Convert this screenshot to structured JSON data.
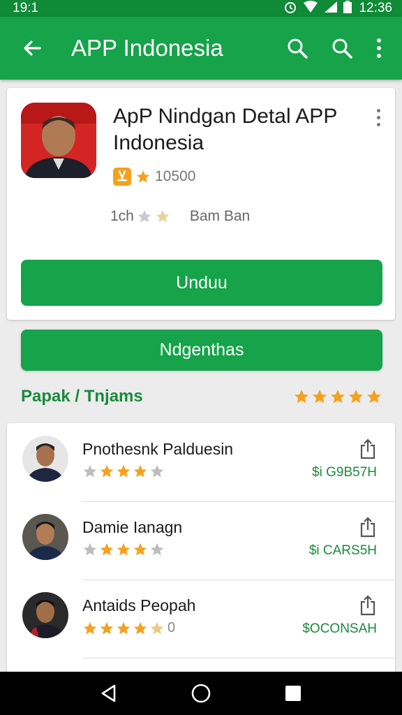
{
  "status_bar": {
    "time_left": "19:1",
    "time_right": "12:36"
  },
  "app_bar": {
    "title": "APP Indonesia"
  },
  "app": {
    "title": "ApP Nindgan Detal APP Indonesia",
    "rating": "10500",
    "meta_value": "1ch",
    "meta_name": "Bam Ban",
    "download_label": "Unduu"
  },
  "secondary_button": {
    "label": "Ndgenthas"
  },
  "section": {
    "title": "Papak / Tnjams",
    "rating": 5
  },
  "reviews": [
    {
      "name": "Pnothesnk Palduesin",
      "stars": 3,
      "price": "$i G9B57H"
    },
    {
      "name": "Damie Ianagn",
      "stars": 3,
      "price": "$i CARS5H"
    },
    {
      "name": "Antaids Peopah",
      "stars": 4.5,
      "star_suffix": "0",
      "price": "$OCONSAH"
    }
  ],
  "colors": {
    "primary": "#16a34a",
    "status_bar": "#0f8a36",
    "star": "#f4a11e",
    "price": "#1a8a3c"
  }
}
